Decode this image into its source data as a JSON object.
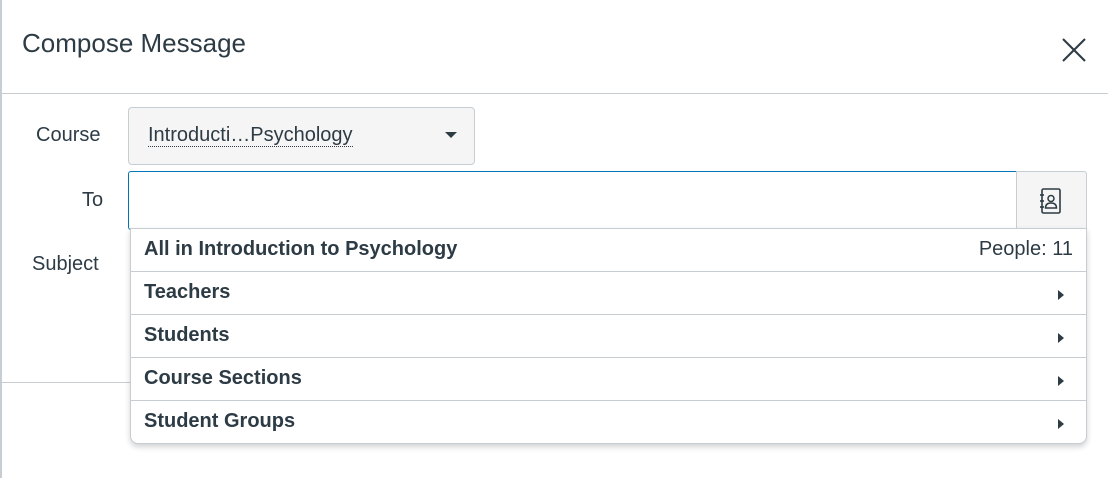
{
  "modal": {
    "title": "Compose Message"
  },
  "form": {
    "course_label": "Course",
    "course_value": "Introducti…Psychology",
    "to_label": "To",
    "to_value": "",
    "subject_label": "Subject"
  },
  "recipients_dropdown": {
    "all_row": {
      "label": "All in Introduction to Psychology",
      "count_text": "People: 11"
    },
    "items": [
      {
        "label": "Teachers"
      },
      {
        "label": "Students"
      },
      {
        "label": "Course Sections"
      },
      {
        "label": "Student Groups"
      }
    ]
  },
  "icons": {
    "close": "close-icon",
    "address_book": "address-book-icon",
    "select_caret": "caret-down-icon",
    "submenu_arrow": "caret-right-icon"
  },
  "colors": {
    "text": "#2d3b45",
    "border": "#c7cdd1",
    "focus_border": "#0374b5",
    "button_bg": "#f5f5f5"
  }
}
